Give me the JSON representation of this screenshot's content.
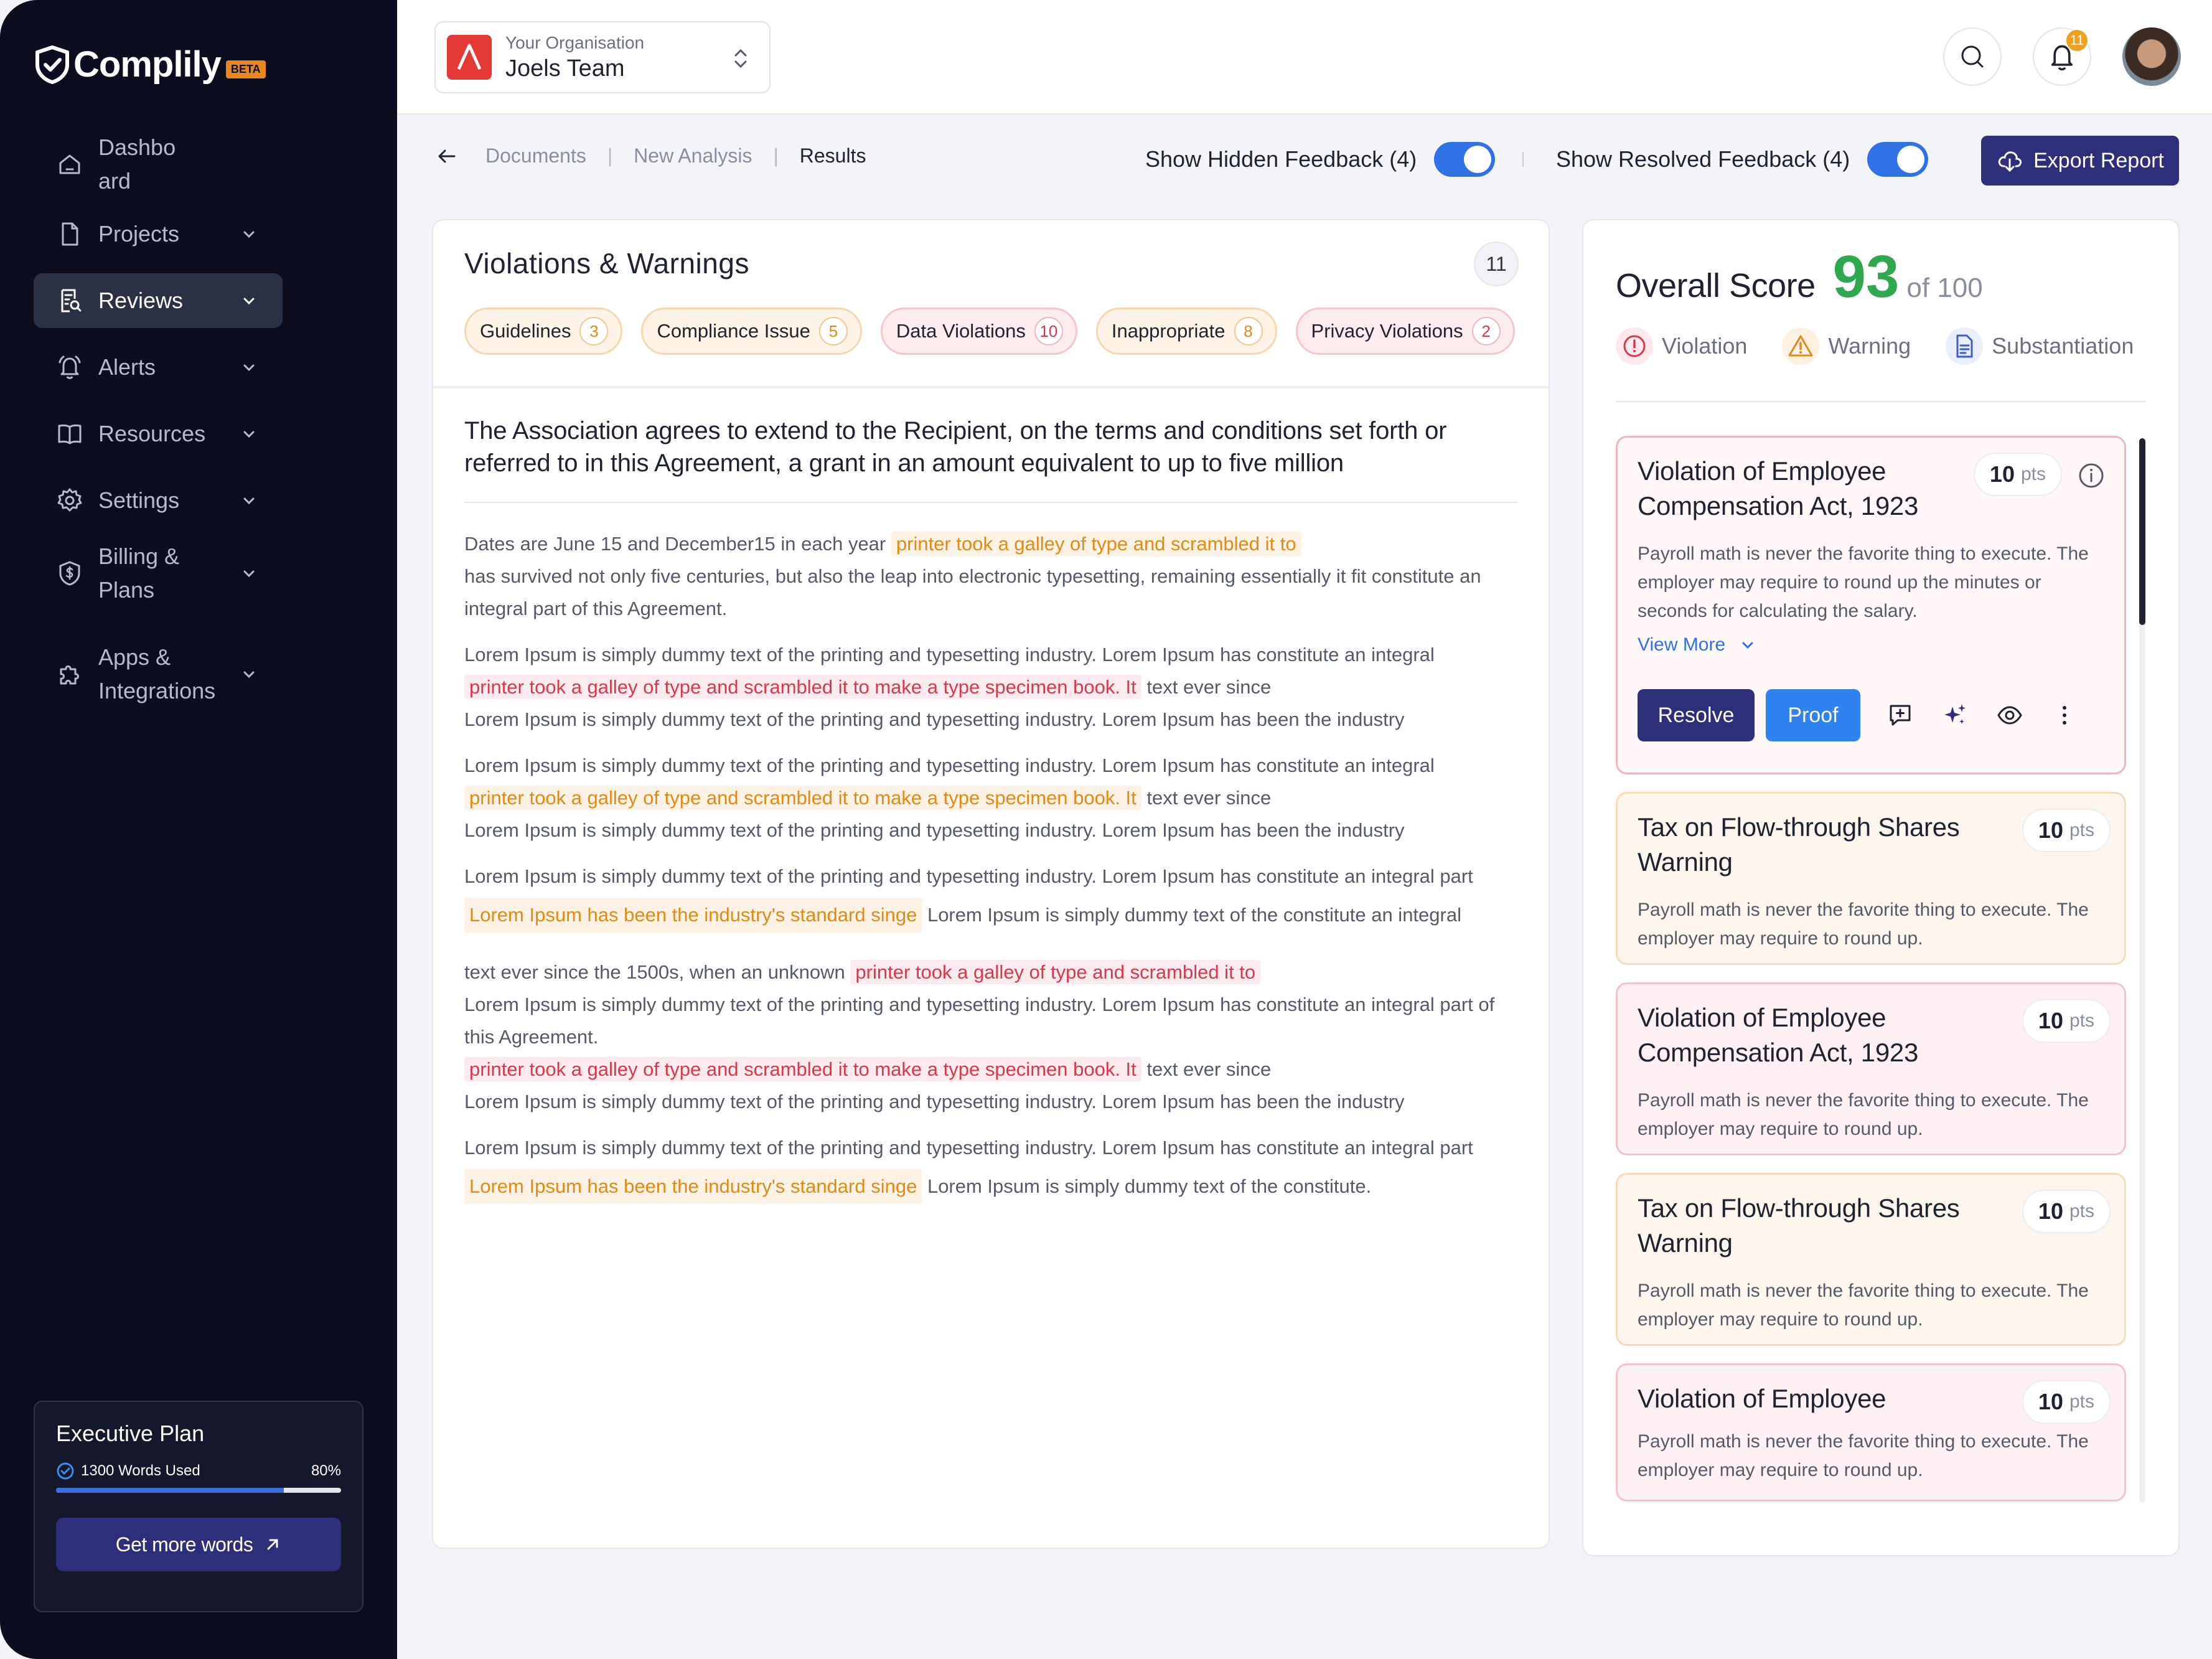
{
  "brand": {
    "name": "Complily",
    "tag": "BETA"
  },
  "sidebar": {
    "items": [
      {
        "label": "Dashbo\nard",
        "icon": "home-icon"
      },
      {
        "label": "Projects",
        "icon": "file-icon"
      },
      {
        "label": "Reviews",
        "icon": "review-icon",
        "active": true
      },
      {
        "label": "Alerts",
        "icon": "bell-icon"
      },
      {
        "label": "Resources",
        "icon": "book-icon"
      },
      {
        "label": "Settings",
        "icon": "gear-icon"
      },
      {
        "label": "Billing & Plans",
        "icon": "shield-dollar-icon"
      },
      {
        "label": "Apps & Integrations",
        "icon": "puzzle-icon"
      }
    ],
    "plan": {
      "title": "Executive Plan",
      "usage_label": "1300 Words Used",
      "usage_percent_label": "80%",
      "usage_fraction": 0.8,
      "cta": "Get more words"
    }
  },
  "topbar": {
    "org_caption": "Your Organisation",
    "org_name": "Joels Team",
    "notification_count": "11"
  },
  "breadcrumb": {
    "items": [
      "Documents",
      "New Analysis",
      "Results"
    ]
  },
  "toggles": {
    "hidden_label": "Show Hidden Feedback (4)",
    "resolved_label": "Show Resolved Feedback (4)"
  },
  "export_label": "Export Report",
  "document": {
    "heading": "Violations & Warnings",
    "count": "11",
    "chips": [
      {
        "label": "Guidelines",
        "n": "3",
        "tone": "amber"
      },
      {
        "label": "Compliance Issue",
        "n": "5",
        "tone": "amber"
      },
      {
        "label": "Data Violations",
        "n": "10",
        "tone": "red"
      },
      {
        "label": "Inappropriate",
        "n": "8",
        "tone": "amber"
      },
      {
        "label": "Privacy Violations",
        "n": "2",
        "tone": "red"
      }
    ],
    "lead": "The Association agrees to extend to the Recipient, on the terms and conditions set forth or referred to in this Agreement, a grant in an amount equivalent to up to five million",
    "p1": {
      "a": "Dates are June 15 and December15 in each year",
      "hl": "printer took a galley of type and scrambled it to",
      "b": "has survived not only five centuries, but also the leap into electronic typesetting, remaining essentially it fit constitute an integral part of this Agreement."
    },
    "p2": {
      "a": "Lorem Ipsum is simply dummy text of the printing and typesetting industry. Lorem Ipsum has constitute an integral",
      "hl": "printer took a galley of type and scrambled it to make a type specimen book. It",
      "b": "text ever since",
      "c": "Lorem Ipsum is simply dummy text of the printing and typesetting industry. Lorem Ipsum has been the industry"
    },
    "p3": {
      "a": "Lorem Ipsum is simply dummy text of the printing and typesetting industry. Lorem Ipsum has constitute an integral",
      "hl": "printer took a galley of type and scrambled it to make a type specimen book. It",
      "b": "text ever since",
      "c": "Lorem Ipsum is simply dummy text of the printing and typesetting industry. Lorem Ipsum has been the industry"
    },
    "p4": {
      "a": "Lorem Ipsum is simply dummy text of the printing and typesetting industry. Lorem Ipsum has constitute an integral part",
      "hl": "Lorem Ipsum has been the industry's standard singe",
      "b": "Lorem Ipsum is simply dummy text of the constitute an integral"
    },
    "p5": {
      "a": "text ever since the 1500s, when an unknown",
      "hl": "printer took a galley of type and scrambled it to",
      "b": "Lorem Ipsum is simply dummy text of the printing and typesetting industry. Lorem Ipsum has constitute an integral part of this Agreement.",
      "hl2": "printer took a galley of type and scrambled it to make a type specimen book. It",
      "c": "text ever since",
      "d": "Lorem Ipsum is simply dummy text of the printing and typesetting industry. Lorem Ipsum has been the industry"
    },
    "p6": {
      "a": "Lorem Ipsum is simply dummy text of the printing and typesetting industry. Lorem Ipsum has constitute an integral part",
      "hl": "Lorem Ipsum has been the industry's standard singe",
      "b": "Lorem Ipsum is simply dummy text of the constitute."
    }
  },
  "score": {
    "label": "Overall Score",
    "value": "93",
    "of": "of 100",
    "legend": [
      "Violation",
      "Warning",
      "Substantiation"
    ],
    "cards": [
      {
        "title": "Violation of Employee Compensation Act, 1923",
        "pts": "10",
        "unit": "pts",
        "desc": "Payroll math is never the favorite thing to execute. The employer may require to round up the minutes or seconds for calculating the salary.",
        "more": "View More",
        "resolve": "Resolve",
        "proof": "Proof"
      },
      {
        "title": "Tax on Flow-through Shares Warning",
        "pts": "10",
        "unit": "pts",
        "desc": "Payroll math is never the favorite thing to execute. The employer may require to round up."
      },
      {
        "title": "Violation of Employee Compensation Act, 1923",
        "pts": "10",
        "unit": "pts",
        "desc": "Payroll math is never the favorite thing to execute. The employer may require to round up."
      },
      {
        "title": "Tax on Flow-through Shares Warning",
        "pts": "10",
        "unit": "pts",
        "desc": "Payroll math is never the favorite thing to execute. The employer may require to round up."
      },
      {
        "title": "Violation of Employee",
        "pts": "10",
        "unit": "pts",
        "desc": "Payroll math is never the favorite thing to execute. The employer may require to round up."
      }
    ]
  },
  "colors": {
    "sidebar": "#0c0e20",
    "primary": "#2f2e7a",
    "accent_blue": "#2f72e6",
    "score_green": "#2fa84f",
    "violation_red": "#d63a4a",
    "warning_amber": "#e08a18"
  }
}
